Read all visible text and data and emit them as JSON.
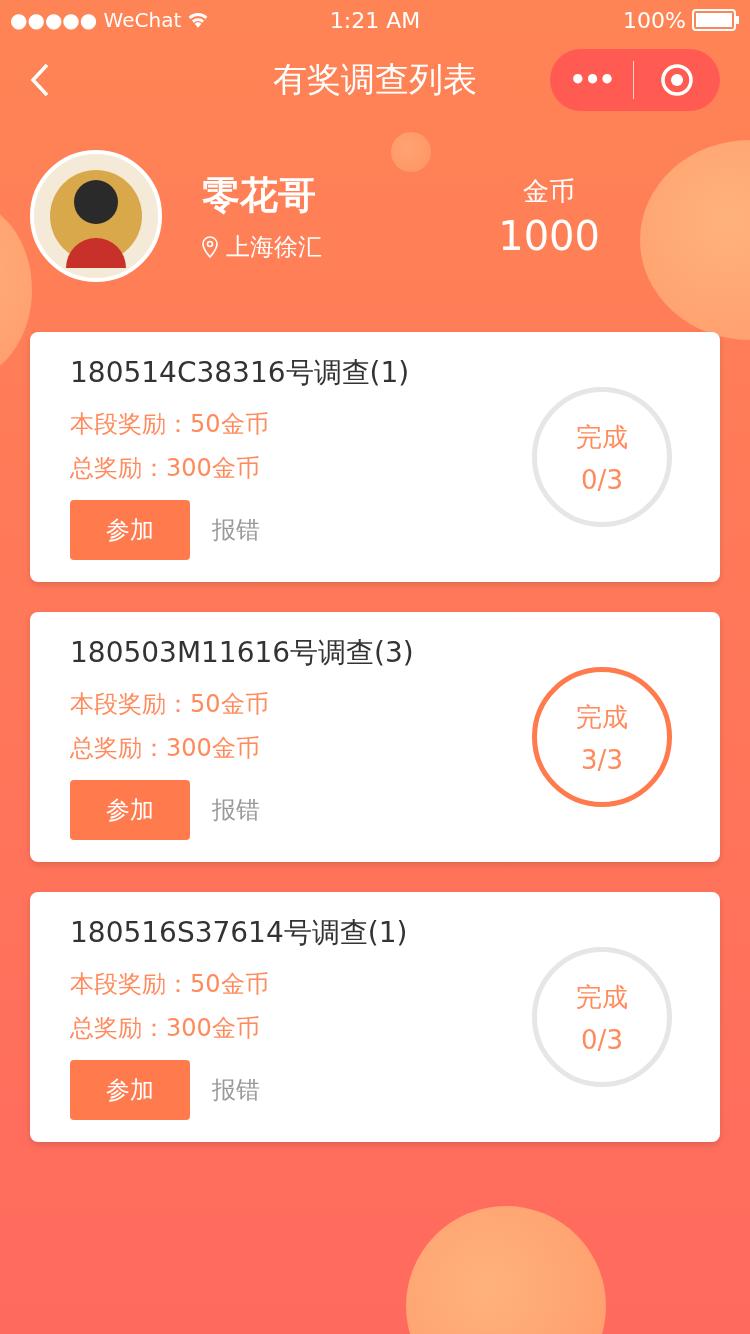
{
  "status_bar": {
    "carrier": "●●●●● WeChat",
    "time": "1:21 AM",
    "battery": "100%"
  },
  "nav": {
    "title": "有奖调查列表",
    "menu_glyph": "•••"
  },
  "profile": {
    "name": "零花哥",
    "location": "上海徐汇",
    "coins_label": "金币",
    "coins": "1000"
  },
  "surveys": [
    {
      "title": "180514C38316号调查(1)",
      "stage_reward": "本段奖励：50金币",
      "total_reward": "总奖励：300金币",
      "join": "参加",
      "report": "报错",
      "status": "完成",
      "progress": "0/3",
      "completed": false
    },
    {
      "title": "180503M11616号调查(3)",
      "stage_reward": "本段奖励：50金币",
      "total_reward": "总奖励：300金币",
      "join": "参加",
      "report": "报错",
      "status": "完成",
      "progress": "3/3",
      "completed": true
    },
    {
      "title": "180516S37614号调查(1)",
      "stage_reward": "本段奖励：50金币",
      "total_reward": "总奖励：300金币",
      "join": "参加",
      "report": "报错",
      "status": "完成",
      "progress": "0/3",
      "completed": false
    }
  ]
}
